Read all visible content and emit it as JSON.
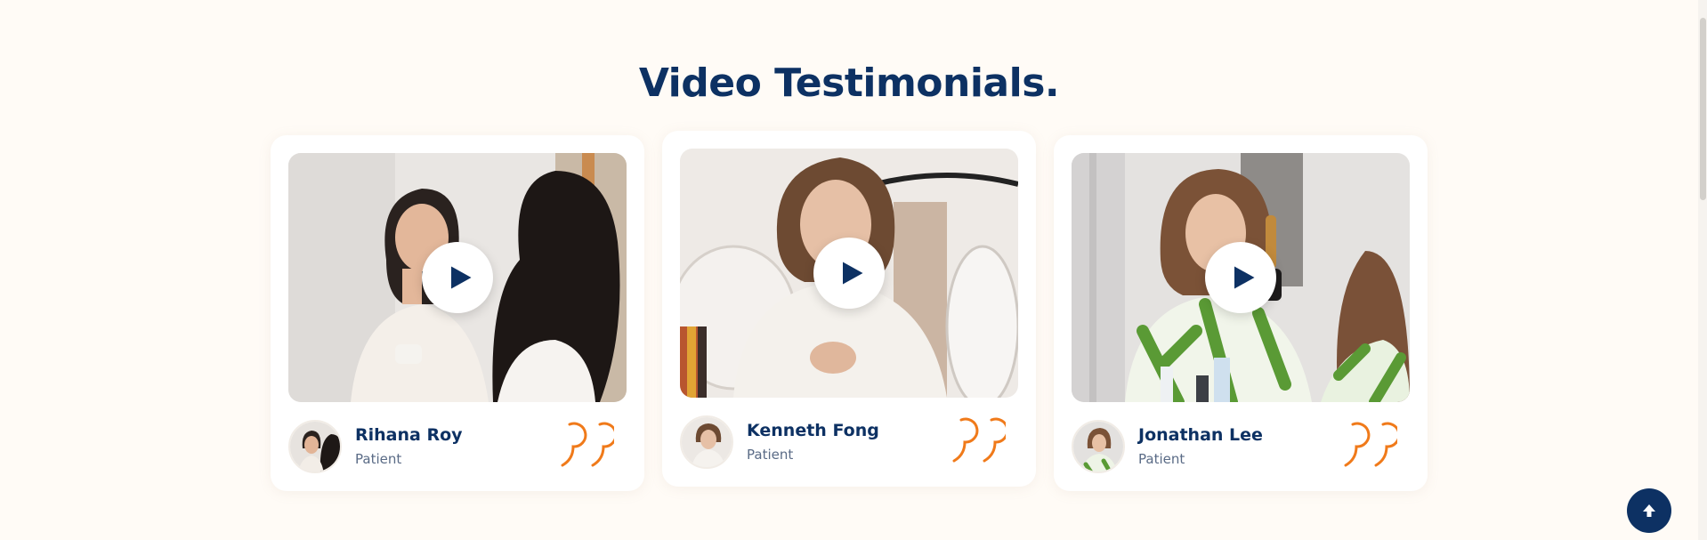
{
  "section": {
    "title": "Video Testimonials."
  },
  "testimonials": [
    {
      "name": "Rihana Roy",
      "role": "Patient",
      "photo": "woman-applying-cream-mirror",
      "action": "play-video"
    },
    {
      "name": "Kenneth Fong",
      "role": "Patient",
      "photo": "woman-smiling-white-shirt",
      "action": "play-video"
    },
    {
      "name": "Jonathan Lee",
      "role": "Patient",
      "photo": "woman-brushing-hair-mirror",
      "action": "play-video"
    }
  ],
  "icons": {
    "play": "play-icon",
    "quote": "quote-icon",
    "back_to_top": "arrow-up-icon"
  },
  "colors": {
    "background": "#fffbf6",
    "heading": "#0d3163",
    "accent": "#f07a1a",
    "subtext": "#5a6b86",
    "card": "#ffffff"
  }
}
